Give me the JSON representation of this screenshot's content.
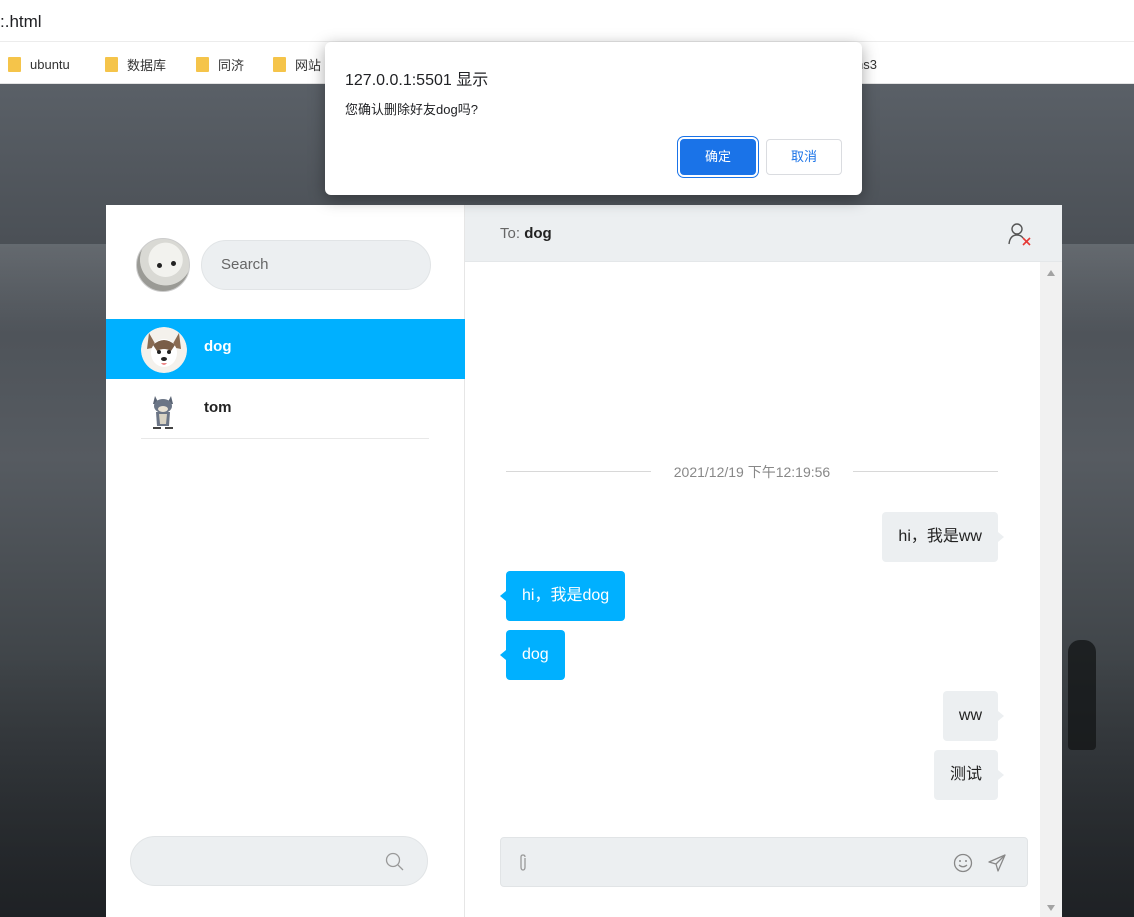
{
  "browser": {
    "url_fragment": ":.html",
    "bookmarks": [
      {
        "label": "ubuntu"
      },
      {
        "label": "数据库"
      },
      {
        "label": "同济"
      },
      {
        "label": "网站"
      }
    ],
    "bookmark_tail": "ns3"
  },
  "dialog": {
    "title": "127.0.0.1:5501 显示",
    "message": "您确认删除好友dog吗?",
    "ok_label": "确定",
    "cancel_label": "取消"
  },
  "sidebar": {
    "search_placeholder": "Search",
    "contacts": [
      {
        "name": "dog",
        "active": true
      },
      {
        "name": "tom",
        "active": false
      }
    ]
  },
  "chat": {
    "to_prefix": "To: ",
    "to_name": "dog",
    "timestamp": "2021/12/19 下午12:19:56",
    "messages": [
      {
        "from": "me",
        "text": "hi，我是ww"
      },
      {
        "from": "them",
        "text": "hi，我是dog"
      },
      {
        "from": "them",
        "text": "dog"
      },
      {
        "from": "me",
        "text": "ww"
      },
      {
        "from": "me",
        "text": "测试"
      }
    ]
  },
  "colors": {
    "accent": "#00b0ff",
    "dialog_primary": "#1a73e8",
    "panel_grey": "#eceff1"
  },
  "icons": {
    "remove_friend": "user-remove-icon",
    "attach": "paperclip-icon",
    "emoji": "smile-icon",
    "send": "send-icon",
    "search": "search-icon"
  }
}
